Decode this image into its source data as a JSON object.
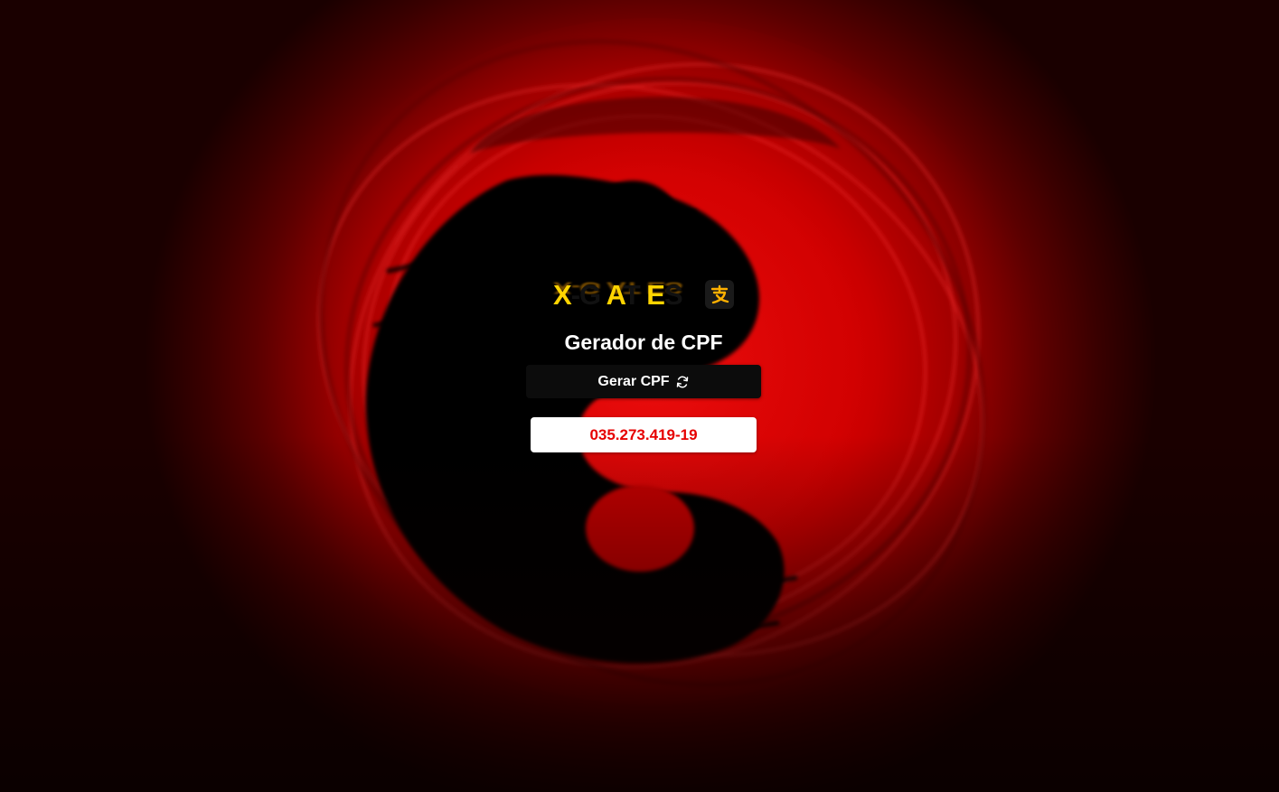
{
  "brand": {
    "logo_parts": [
      {
        "text": "X",
        "color": "yellow"
      },
      {
        "text": "-G ",
        "color": "black"
      },
      {
        "text": "A",
        "color": "yellow"
      },
      {
        "text": "T ",
        "color": "black"
      },
      {
        "text": "E",
        "color": "yellow"
      },
      {
        "text": "S",
        "color": "black"
      }
    ],
    "badge_icon": "alipay-icon",
    "colors": {
      "yellow": "#ffd400",
      "black": "#111111"
    }
  },
  "main": {
    "title": "Gerador de CPF",
    "generate_label": "Gerar CPF",
    "generate_icon": "refresh-icon",
    "result_value": "035.273.419-19"
  },
  "theme": {
    "background": "yin-yang swirl",
    "accent": "#e60000",
    "button_bg": "#0c0c0c",
    "result_text_color": "#e60000"
  }
}
